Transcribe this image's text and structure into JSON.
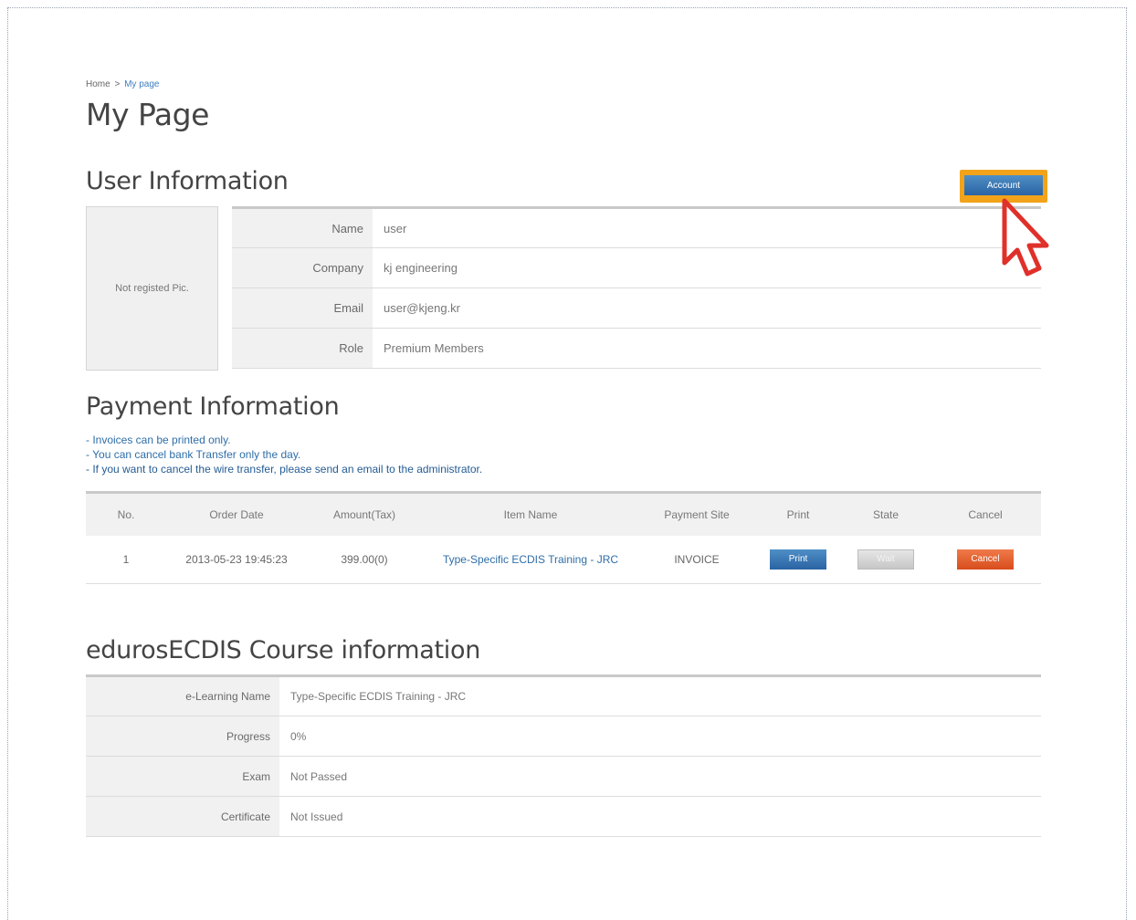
{
  "breadcrumb": {
    "home": "Home",
    "separator": ">",
    "current": "My page"
  },
  "page_title": "My Page",
  "user_section": {
    "title": "User Information",
    "account_button": "Account",
    "photo_placeholder": "Not registed Pic.",
    "rows": [
      {
        "label": "Name",
        "value": "user"
      },
      {
        "label": "Company",
        "value": "kj engineering"
      },
      {
        "label": "Email",
        "value": "user@kjeng.kr"
      },
      {
        "label": "Role",
        "value": "Premium Members"
      }
    ]
  },
  "payment_section": {
    "title": "Payment Information",
    "notes": [
      "- Invoices can be printed only.",
      "- You can cancel bank Transfer only the day.",
      "- If you want to cancel the wire transfer, please send an email to the administrator."
    ],
    "columns": [
      "No.",
      "Order Date",
      "Amount(Tax)",
      "Item Name",
      "Payment Site",
      "Print",
      "State",
      "Cancel"
    ],
    "rows": [
      {
        "no": "1",
        "order_date": "2013-05-23 19:45:23",
        "amount": "399.00(0)",
        "item_name": "Type-Specific ECDIS Training - JRC",
        "payment_site": "INVOICE",
        "print_label": "Print",
        "state_label": "Wait",
        "cancel_label": "Cancel"
      }
    ]
  },
  "course_section": {
    "title": "edurosECDIS Course information",
    "rows": [
      {
        "label": "e-Learning Name",
        "value": "Type-Specific ECDIS Training - JRC"
      },
      {
        "label": "Progress",
        "value": "0%"
      },
      {
        "label": "Exam",
        "value": "Not Passed"
      },
      {
        "label": "Certificate",
        "value": "Not Issued"
      }
    ]
  },
  "colors": {
    "accent_blue": "#2a63a3",
    "highlight_orange": "#f2a31a",
    "cancel_red": "#d84d1c",
    "pointer_red": "#e0302a"
  },
  "icons": {
    "cursor": "pointer-cursor-icon"
  }
}
